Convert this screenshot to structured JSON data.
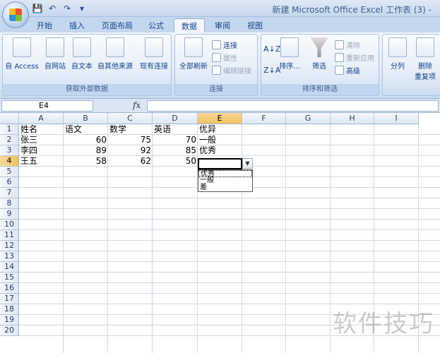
{
  "window": {
    "title": "新建 Microsoft Office Excel 工作表 (3) -"
  },
  "qat": [
    "💾",
    "↶",
    "↷",
    "▾"
  ],
  "tabs": [
    {
      "label": "开始"
    },
    {
      "label": "插入"
    },
    {
      "label": "页面布局"
    },
    {
      "label": "公式"
    },
    {
      "label": "数据"
    },
    {
      "label": "审阅"
    },
    {
      "label": "视图"
    }
  ],
  "ribbon": {
    "external_data": {
      "label": "获取外部数据",
      "buttons": [
        "自 Access",
        "自网站",
        "自文本",
        "自其他来源",
        "现有连接"
      ]
    },
    "connections": {
      "label": "连接",
      "refresh_label": "全部刷新",
      "small": [
        "连接",
        "属性",
        "编辑链接"
      ]
    },
    "sort_filter": {
      "label": "排序和筛选",
      "sort_label": "排序...",
      "filter_label": "筛选",
      "small": [
        "清除",
        "重新应用",
        "高级"
      ]
    },
    "data_tools": {
      "split_label": "分列",
      "remove_label": "删除",
      "remove_sub": "重复项"
    }
  },
  "formula_bar": {
    "name_box": "E4",
    "fx": "fx",
    "content": ""
  },
  "columns": [
    "A",
    "B",
    "C",
    "D",
    "E",
    "F",
    "G",
    "H",
    "I"
  ],
  "rows": [
    "1",
    "2",
    "3",
    "4",
    "5",
    "6",
    "7",
    "8",
    "9",
    "10",
    "11",
    "12",
    "13",
    "14",
    "15",
    "16",
    "17",
    "18",
    "19",
    "20"
  ],
  "table": {
    "headers": [
      "姓名",
      "语文",
      "数学",
      "英语",
      "优异"
    ],
    "rows": [
      {
        "name": "张三",
        "chinese": "60",
        "math": "75",
        "english": "70",
        "grade": "一般"
      },
      {
        "name": "李四",
        "chinese": "89",
        "math": "92",
        "english": "85",
        "grade": "优秀"
      },
      {
        "name": "王五",
        "chinese": "58",
        "math": "62",
        "english": "50",
        "grade": ""
      }
    ]
  },
  "dropdown": {
    "arrow": "▼",
    "options": [
      "优秀",
      "一般",
      "差"
    ]
  },
  "watermark": "软件技巧"
}
